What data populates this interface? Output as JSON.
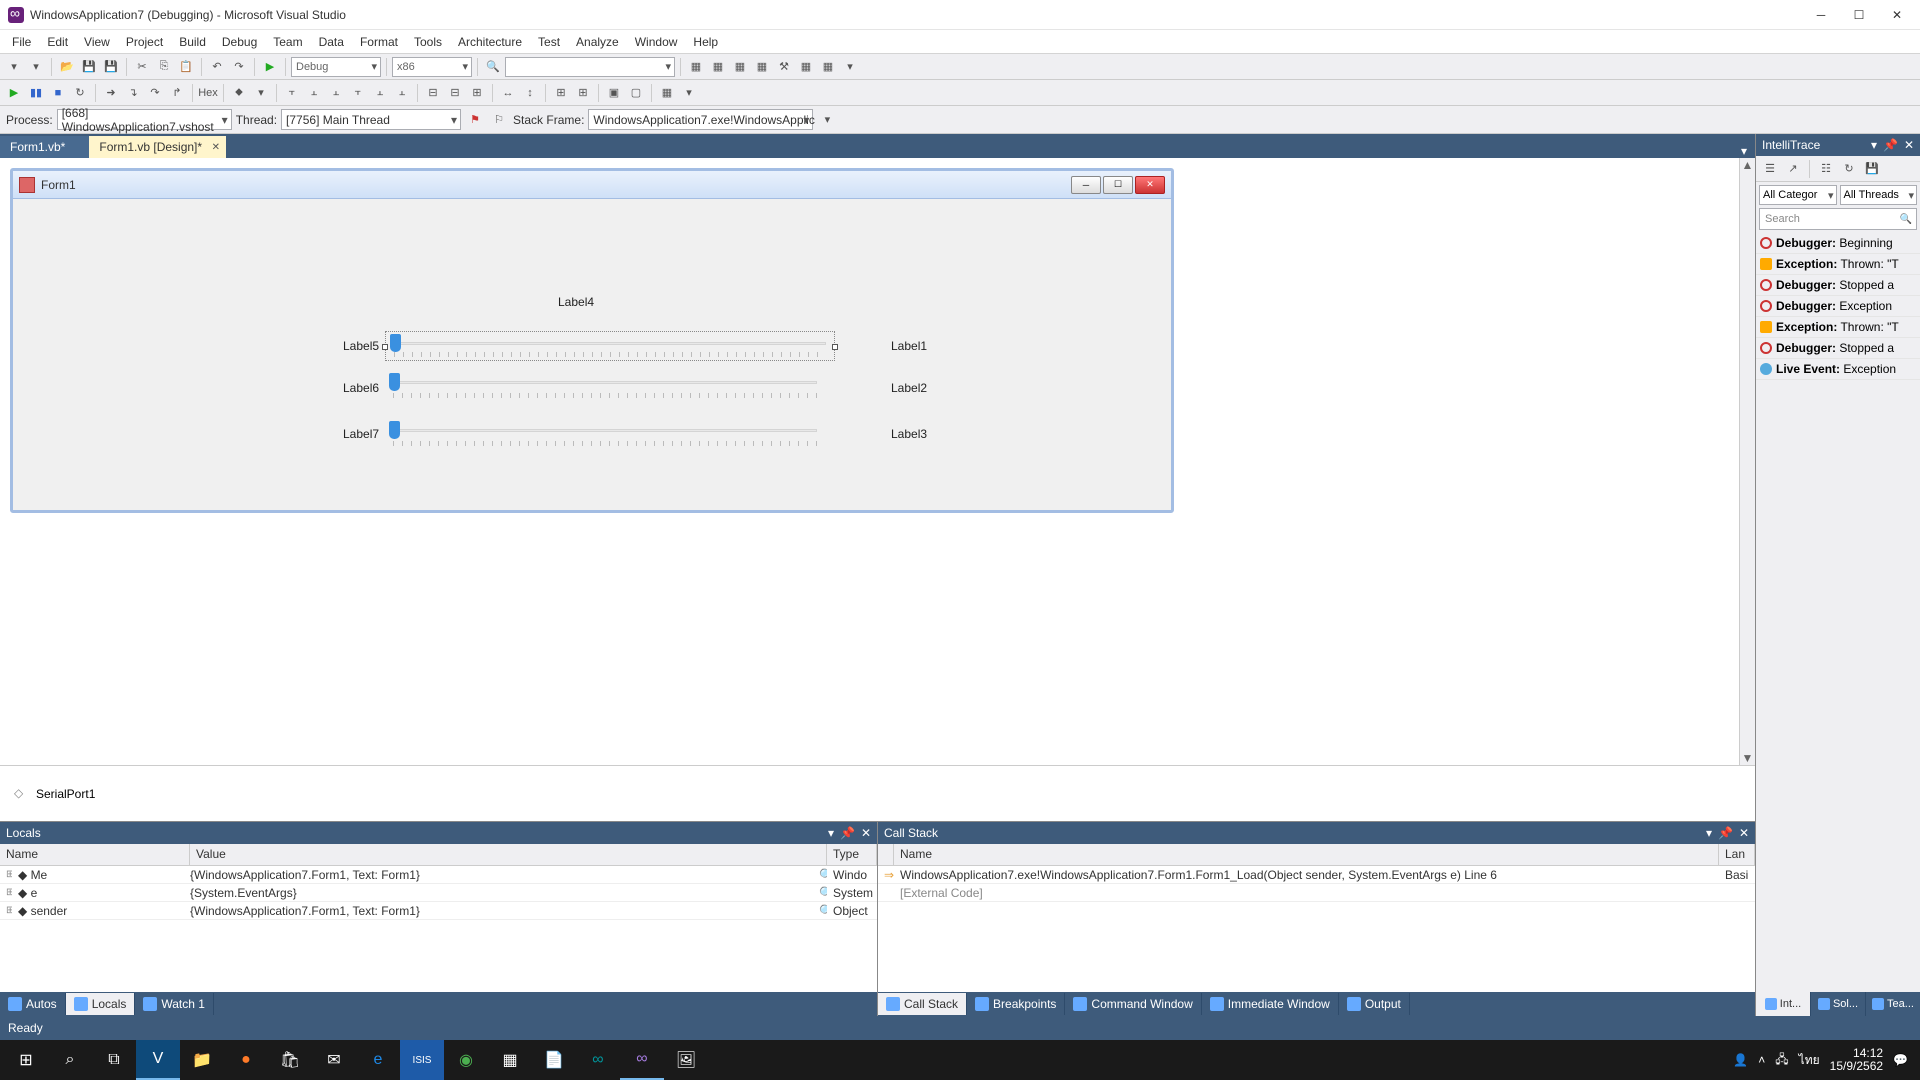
{
  "title": "WindowsApplication7 (Debugging) - Microsoft Visual Studio",
  "menus": [
    "File",
    "Edit",
    "View",
    "Project",
    "Build",
    "Debug",
    "Team",
    "Data",
    "Format",
    "Tools",
    "Architecture",
    "Test",
    "Analyze",
    "Window",
    "Help"
  ],
  "toolbar": {
    "config": "Debug",
    "platform": "x86",
    "hex": "Hex"
  },
  "procbar": {
    "processLbl": "Process:",
    "process": "[668] WindowsApplication7.vshost",
    "threadLbl": "Thread:",
    "thread": "[7756] Main Thread",
    "stackLbl": "Stack Frame:",
    "stack": "WindowsApplication7.exe!WindowsApplic"
  },
  "tabs": {
    "inactive": "Form1.vb*",
    "active": "Form1.vb [Design]*"
  },
  "form": {
    "title": "Form1",
    "labels": {
      "l1": "Label1",
      "l2": "Label2",
      "l3": "Label3",
      "l4": "Label4",
      "l5": "Label5",
      "l6": "Label6",
      "l7": "Label7"
    },
    "component": "SerialPort1"
  },
  "intellitrace": {
    "title": "IntelliTrace",
    "filter1": "All Categor",
    "filter2": "All Threads",
    "search": "Search",
    "events": [
      {
        "icon": "red",
        "b": "Debugger:",
        "t": " Beginning"
      },
      {
        "icon": "orange",
        "b": "Exception:",
        "t": " Thrown: \"T"
      },
      {
        "icon": "red",
        "b": "Debugger:",
        "t": " Stopped a"
      },
      {
        "icon": "red",
        "b": "Debugger:",
        "t": " Exception"
      },
      {
        "icon": "orange",
        "b": "Exception:",
        "t": " Thrown: \"T"
      },
      {
        "icon": "red",
        "b": "Debugger:",
        "t": " Stopped a"
      },
      {
        "icon": "blue",
        "b": "Live Event:",
        "t": " Exception"
      }
    ]
  },
  "locals": {
    "title": "Locals",
    "headers": {
      "name": "Name",
      "value": "Value",
      "type": "Type"
    },
    "rows": [
      {
        "name": "Me",
        "value": "{WindowsApplication7.Form1, Text: Form1}",
        "type": "Windo"
      },
      {
        "name": "e",
        "value": "{System.EventArgs}",
        "type": "System"
      },
      {
        "name": "sender",
        "value": "{WindowsApplication7.Form1, Text: Form1}",
        "type": "Object"
      }
    ]
  },
  "callstack": {
    "title": "Call Stack",
    "headers": {
      "name": "Name",
      "lang": "Lan"
    },
    "rows": [
      {
        "arrow": "⇒",
        "name": "WindowsApplication7.exe!WindowsApplication7.Form1.Form1_Load(Object sender, System.EventArgs e) Line 6",
        "lang": "Basi"
      },
      {
        "arrow": "",
        "name": "[External Code]",
        "lang": ""
      }
    ]
  },
  "bottomTabsL": [
    {
      "label": "Autos",
      "active": false
    },
    {
      "label": "Locals",
      "active": true
    },
    {
      "label": "Watch 1",
      "active": false
    }
  ],
  "bottomTabsR": [
    {
      "label": "Call Stack",
      "active": true
    },
    {
      "label": "Breakpoints",
      "active": false
    },
    {
      "label": "Command Window",
      "active": false
    },
    {
      "label": "Immediate Window",
      "active": false
    },
    {
      "label": "Output",
      "active": false
    }
  ],
  "rightTabs": [
    {
      "label": "Int...",
      "active": true
    },
    {
      "label": "Sol...",
      "active": false
    },
    {
      "label": "Tea...",
      "active": false
    }
  ],
  "status": "Ready",
  "taskbar": {
    "time": "14:12",
    "date": "15/9/2562",
    "lang": "ไทย"
  }
}
